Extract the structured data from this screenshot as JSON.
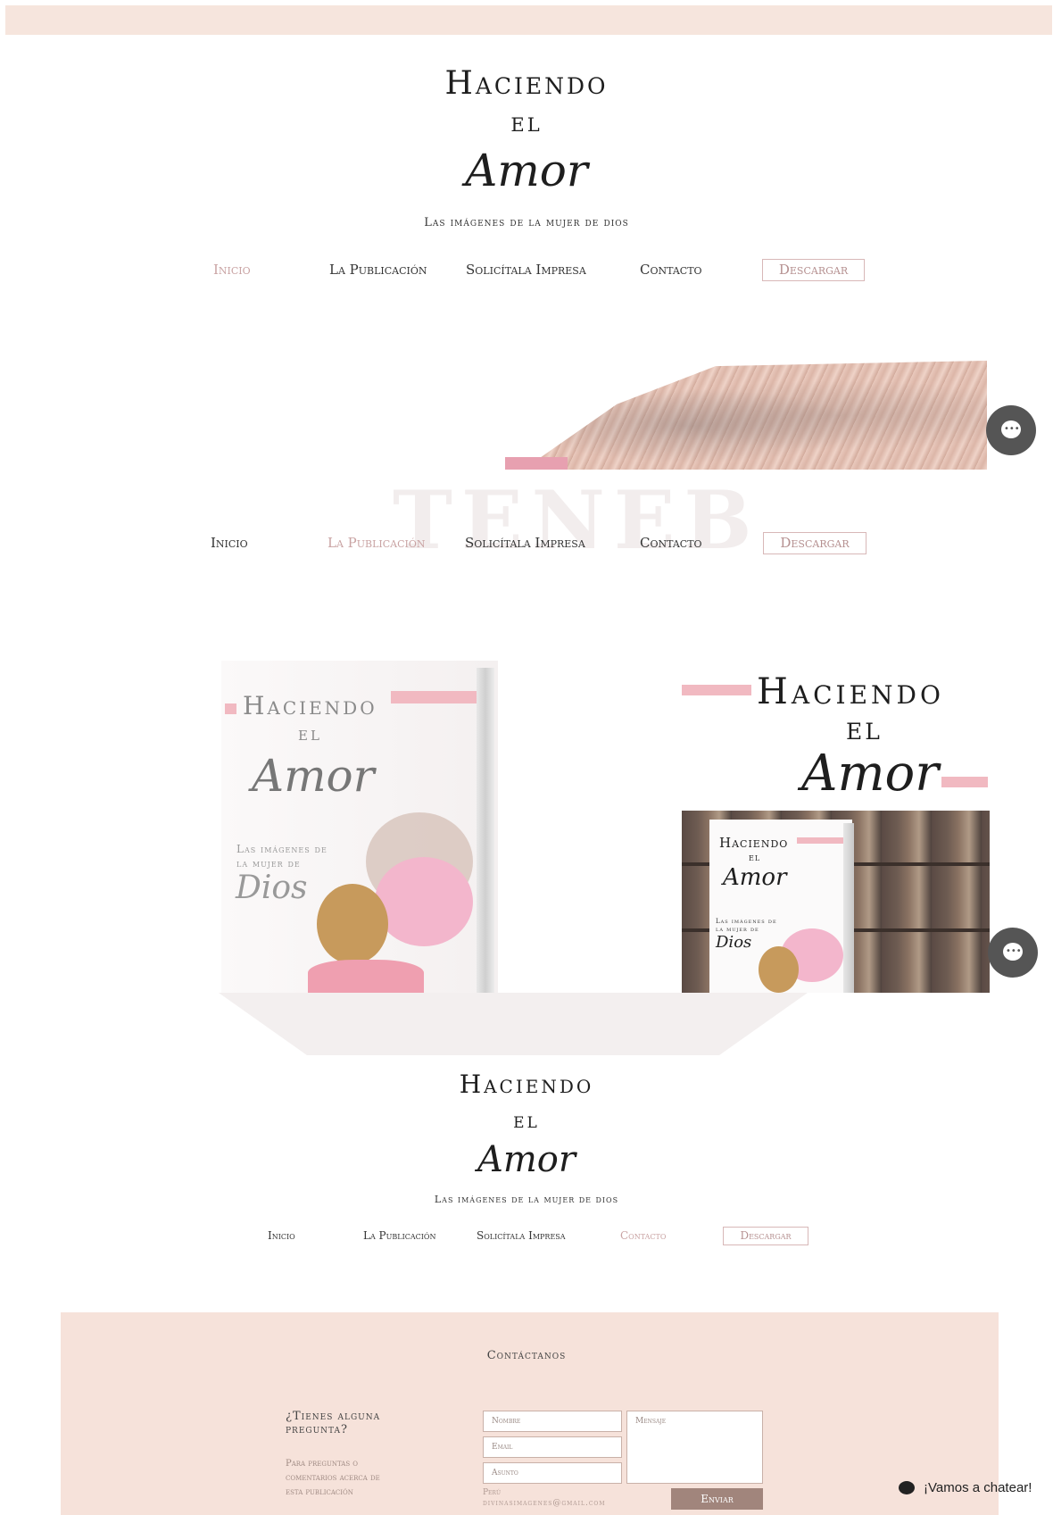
{
  "header": {
    "title_line1": "Haciendo",
    "title_line2": "el",
    "title_script": "Amor",
    "subtitle": "Las imágenes de la mujer de dios"
  },
  "nav1": {
    "items": [
      "Inicio",
      "La Publicación",
      "Solicítala Impresa",
      "Contacto"
    ],
    "button": "Descargar",
    "active": "Inicio"
  },
  "nav2": {
    "items": [
      "Inicio",
      "La Publicación",
      "Solicítala Impresa",
      "Contacto"
    ],
    "button": "Descargar",
    "active": "La Publicación"
  },
  "nav3": {
    "items": [
      "Inicio",
      "La Publicación",
      "Solicítala Impresa",
      "Contacto"
    ],
    "button": "Descargar",
    "active": "Contacto"
  },
  "watermark": "TENEB",
  "book_left": {
    "title_line1": "Haciendo",
    "title_line2": "el",
    "title_script": "Amor",
    "subtitle_line1": "Las imágenes de",
    "subtitle_line2": "la mujer de",
    "script2": "Dios"
  },
  "book_right": {
    "title_line1": "Haciendo",
    "title_line2": "el",
    "title_script": "Amor"
  },
  "book_mini": {
    "title_line1": "Haciendo",
    "title_line2": "el",
    "title_script": "Amor",
    "subtitle_line1": "Las imágenes de",
    "subtitle_line2": "la mujer de",
    "script2": "Dios"
  },
  "footer_title": {
    "title_line1": "Haciendo",
    "title_line2": "el",
    "title_script": "Amor",
    "subtitle": "Las imágenes de la mujer de dios"
  },
  "contact": {
    "heading": "Contáctanos",
    "question_line1": "¿Tienes alguna",
    "question_line2": "pregunta?",
    "info_line1": "Para preguntas o",
    "info_line2": "comentarios acerca de",
    "info_line3": "esta publicación",
    "country": "Perú",
    "email": "divinasimagenes@gmail.com",
    "name_placeholder": "Nombre",
    "email_placeholder": "Email",
    "subject_placeholder": "Asunto",
    "message_placeholder": "Mensaje",
    "send_label": "Enviar"
  },
  "chat": {
    "widget_label": "¡Vamos a chatear!",
    "dots": "•••"
  },
  "colors": {
    "accent_pink": "#f1b9c1",
    "band": "#f6e5dd",
    "active_nav": "#c9a3a3",
    "send_button": "#a1857c"
  }
}
